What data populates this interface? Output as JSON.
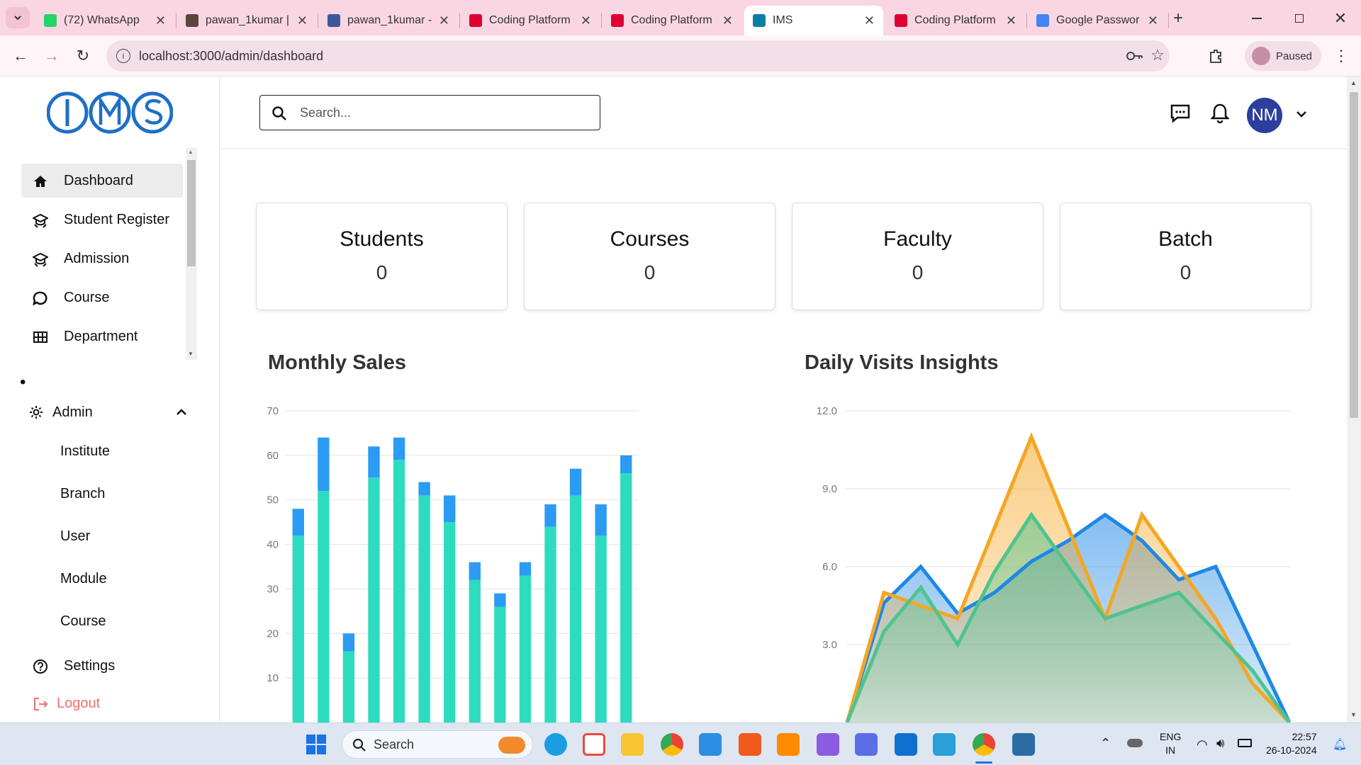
{
  "browser": {
    "tabs": [
      {
        "title": "(72) WhatsApp",
        "icon": "whatsapp-icon",
        "color": "#25d366"
      },
      {
        "title": "pawan_1kumar |",
        "icon": "codechef-icon",
        "color": "#5b4638"
      },
      {
        "title": "pawan_1kumar -",
        "icon": "codeforces-icon",
        "color": "#3b5998"
      },
      {
        "title": "Coding Platform",
        "icon": "angular-icon",
        "color": "#dd0031"
      },
      {
        "title": "Coding Platform",
        "icon": "angular-icon",
        "color": "#dd0031"
      },
      {
        "title": "IMS",
        "icon": "react-icon",
        "color": "#0a7ea4",
        "active": true
      },
      {
        "title": "Coding Platform",
        "icon": "angular-icon",
        "color": "#dd0031"
      },
      {
        "title": "Google Passwor",
        "icon": "google-password-icon",
        "color": "#4285f4"
      }
    ],
    "url": "localhost:3000/admin/dashboard",
    "profile_label": "Paused"
  },
  "app": {
    "logo_text": "IMS",
    "search_placeholder": "Search...",
    "avatar_initials": "NM",
    "accent": "#1e6fc5",
    "avatar_color": "#2c3e9e"
  },
  "sidebar": {
    "items": [
      {
        "label": "Dashboard",
        "icon": "home-icon",
        "active": true
      },
      {
        "label": "Student Register",
        "icon": "graduation-icon"
      },
      {
        "label": "Admission",
        "icon": "graduation-icon"
      },
      {
        "label": "Course",
        "icon": "chat-bubble-icon"
      },
      {
        "label": "Department",
        "icon": "grid-icon"
      }
    ],
    "bullet": "•",
    "admin_label": "Admin",
    "admin_subitems": [
      "Institute",
      "Branch",
      "User",
      "Module",
      "Course"
    ],
    "settings_label": "Settings",
    "logout_label": "Logout"
  },
  "stats": [
    {
      "label": "Students",
      "value": "0"
    },
    {
      "label": "Courses",
      "value": "0"
    },
    {
      "label": "Faculty",
      "value": "0"
    },
    {
      "label": "Batch",
      "value": "0"
    }
  ],
  "chart_data": [
    {
      "type": "bar",
      "title": "Monthly Sales",
      "ylim": [
        0,
        70
      ],
      "yticks": [
        "10",
        "20",
        "30",
        "40",
        "50",
        "60",
        "70"
      ],
      "stacked": true,
      "series": [
        {
          "values": [
            42,
            52,
            16,
            55,
            59,
            51,
            45,
            32,
            26,
            33,
            44,
            51,
            42,
            56
          ],
          "color": "#2ddcc0"
        },
        {
          "values": [
            6,
            12,
            4,
            7,
            5,
            3,
            6,
            4,
            3,
            3,
            5,
            6,
            7,
            4
          ],
          "color": "#2b9bf4"
        }
      ],
      "grid": true
    },
    {
      "type": "area",
      "title": "Daily Visits Insights",
      "ylim": [
        0,
        12
      ],
      "yticks": [
        "3.0",
        "6.0",
        "9.0",
        "12.0"
      ],
      "x": [
        0,
        1,
        2,
        3,
        4,
        5,
        6,
        7,
        8,
        9,
        10,
        11,
        12
      ],
      "series": [
        {
          "values": [
            0,
            4.6,
            6.0,
            4.2,
            5.0,
            6.2,
            7.0,
            8.0,
            7.0,
            5.5,
            6.0,
            3.0,
            0
          ],
          "color": "#1e88e5"
        },
        {
          "values": [
            0,
            5.0,
            4.5,
            4.0,
            7.5,
            11.0,
            7.5,
            4.0,
            8.0,
            6.0,
            4.0,
            1.5,
            0
          ],
          "color": "#f5a623"
        },
        {
          "values": [
            0,
            3.5,
            5.2,
            3.0,
            5.8,
            8.0,
            6.0,
            4.0,
            4.5,
            5.0,
            3.5,
            2.0,
            0
          ],
          "color": "#4fc38f"
        }
      ],
      "grid": true
    }
  ],
  "taskbar": {
    "search_placeholder": "Search",
    "lang": "ENG",
    "region": "IN",
    "time": "22:57",
    "date": "26-10-2024"
  }
}
